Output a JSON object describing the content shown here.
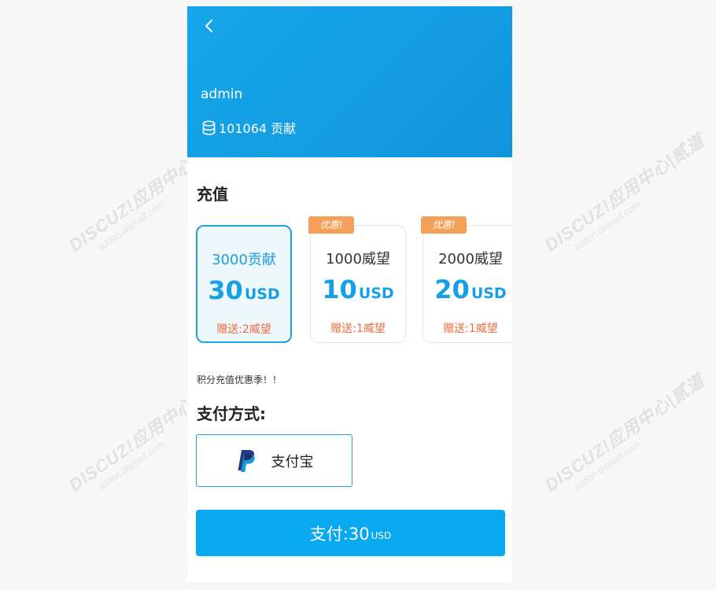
{
  "header": {
    "username": "admin",
    "balance": "101064 贡献"
  },
  "recharge": {
    "title": "充值",
    "packages": [
      {
        "amount": "3000贡献",
        "price": "30",
        "currency": "USD",
        "gift": "赠送:2威望",
        "badge": "",
        "selected": true
      },
      {
        "amount": "1000威望",
        "price": "10",
        "currency": "USD",
        "gift": "赠送:1威望",
        "badge": "优惠!",
        "selected": false
      },
      {
        "amount": "2000威望",
        "price": "20",
        "currency": "USD",
        "gift": "赠送:1威望",
        "badge": "优惠!",
        "selected": false
      }
    ],
    "promo": "积分充值优惠季！！"
  },
  "payment": {
    "title": "支付方式:",
    "method_label": "支付宝",
    "method_icon": "paypal-icon"
  },
  "submit": {
    "label": "支付:30",
    "currency": "USD"
  },
  "watermark": {
    "brand": "DISCUZ!应用中心|贰道",
    "url": "addon.dismall.com"
  },
  "colors": {
    "header": "#16a6ea",
    "accent": "#08a9ef",
    "badge": "#f4a05a",
    "gift": "#ef6a3e"
  }
}
